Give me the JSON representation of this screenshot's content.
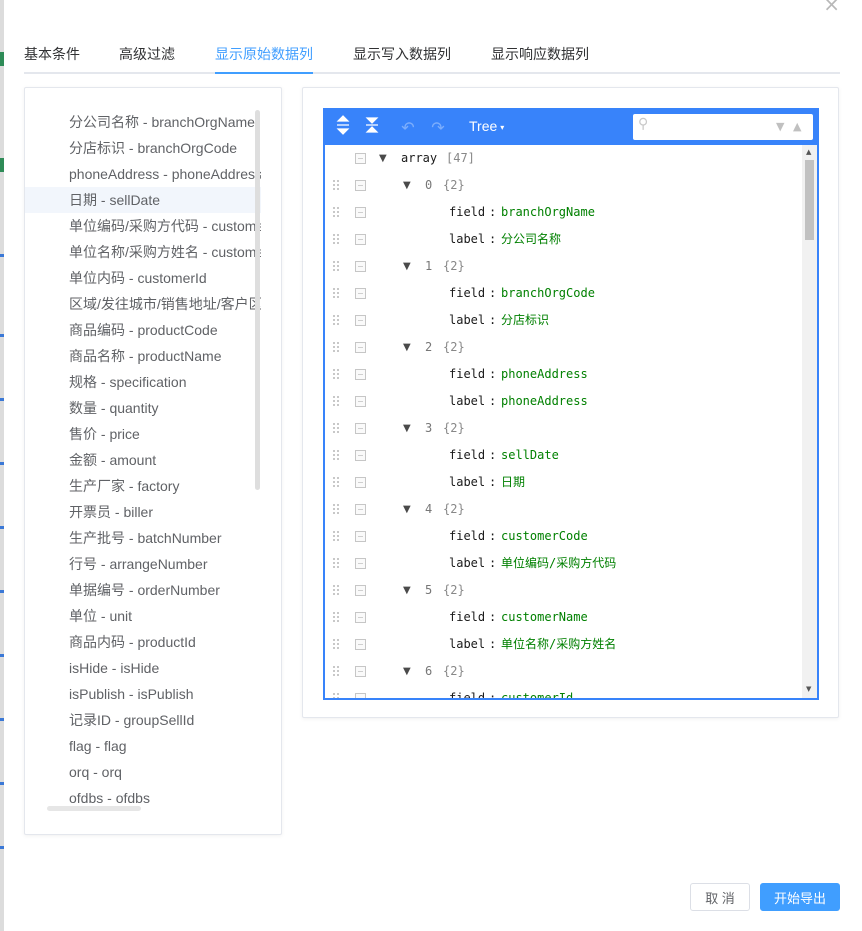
{
  "dialog": {
    "close_glyph": "×"
  },
  "tabs": [
    {
      "label": "基本条件"
    },
    {
      "label": "高级过滤"
    },
    {
      "label": "显示原始数据列"
    },
    {
      "label": "显示写入数据列"
    },
    {
      "label": "显示响应数据列"
    }
  ],
  "active_tab": 2,
  "fields": [
    "分公司名称 - branchOrgName",
    "分店标识 - branchOrgCode",
    "phoneAddress - phoneAddress",
    "日期 - sellDate",
    "单位编码/采购方代码 - customerCode",
    "单位名称/采购方姓名 - customerName",
    "单位内码 - customerId",
    "区域/发往城市/销售地址/客户区域",
    "商品编码 - productCode",
    "商品名称 - productName",
    "规格 - specification",
    "数量 - quantity",
    "售价 - price",
    "金额 - amount",
    "生产厂家 - factory",
    "开票员 - biller",
    "生产批号 - batchNumber",
    "行号 - arrangeNumber",
    "单据编号 - orderNumber",
    "单位 - unit",
    "商品内码 - productId",
    "isHide - isHide",
    "isPublish - isPublish",
    "记录ID - groupSellId",
    "flag - flag",
    "orq - orq",
    "ofdbs - ofdbs"
  ],
  "selected_field": 3,
  "editor": {
    "mode_label": "Tree",
    "mode_caret": "▾",
    "search_placeholder": "",
    "root_key": "array",
    "root_meta": "[47]",
    "items": [
      {
        "index": "0",
        "meta": "{2}",
        "field": "branchOrgName",
        "label": "分公司名称"
      },
      {
        "index": "1",
        "meta": "{2}",
        "field": "branchOrgCode",
        "label": "分店标识"
      },
      {
        "index": "2",
        "meta": "{2}",
        "field": "phoneAddress",
        "label": "phoneAddress"
      },
      {
        "index": "3",
        "meta": "{2}",
        "field": "sellDate",
        "label": "日期"
      },
      {
        "index": "4",
        "meta": "{2}",
        "field": "customerCode",
        "label": "单位编码/采购方代码"
      },
      {
        "index": "5",
        "meta": "{2}",
        "field": "customerName",
        "label": "单位名称/采购方姓名"
      },
      {
        "index": "6",
        "meta": "{2}",
        "field": "customerId"
      }
    ],
    "key_field": "field",
    "key_label": "label",
    "separator": ":",
    "icons": {
      "expand_all": "expand-all-icon",
      "collapse_all": "collapse-all-icon",
      "undo": "undo-icon",
      "redo": "redo-icon",
      "search": "search-icon"
    },
    "accent_color": "#3883fa",
    "value_color": "#008000"
  },
  "buttons": {
    "cancel": "取 消",
    "confirm": "开始导出"
  },
  "colors": {
    "primary": "#409eff",
    "text": "#606266"
  }
}
